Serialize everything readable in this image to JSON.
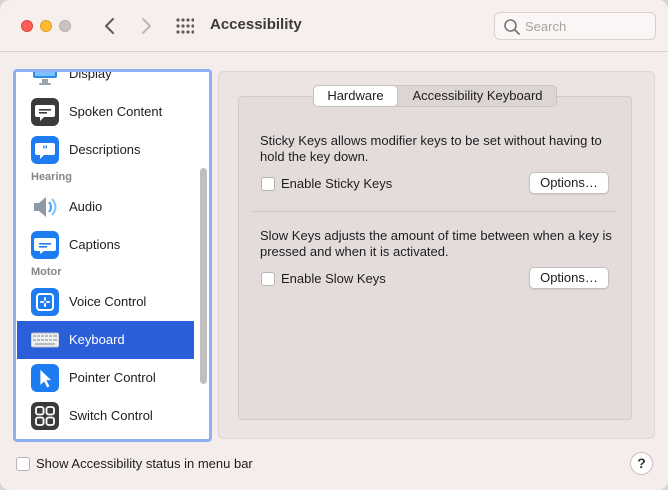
{
  "window": {
    "title": "Accessibility",
    "search_placeholder": "Search"
  },
  "sidebar": {
    "items": [
      {
        "label": "Display",
        "icon": "display-icon"
      },
      {
        "label": "Spoken Content",
        "icon": "spoken-content-icon"
      },
      {
        "label": "Descriptions",
        "icon": "descriptions-icon"
      },
      {
        "label": "Audio",
        "icon": "speaker-icon"
      },
      {
        "label": "Captions",
        "icon": "captions-icon"
      },
      {
        "label": "Voice Control",
        "icon": "voice-control-icon"
      },
      {
        "label": "Keyboard",
        "icon": "keyboard-icon",
        "selected": true
      },
      {
        "label": "Pointer Control",
        "icon": "pointer-icon"
      },
      {
        "label": "Switch Control",
        "icon": "switch-control-icon"
      }
    ],
    "sections": [
      "Hearing",
      "Motor"
    ],
    "selected_color": "#2b5fd9"
  },
  "tabs": [
    "Hardware",
    "Accessibility Keyboard"
  ],
  "sticky_keys": {
    "description": "Sticky Keys allows modifier keys to be set without having to hold the key down.",
    "checkbox_label": "Enable Sticky Keys",
    "options_label": "Options…"
  },
  "slow_keys": {
    "description": "Slow Keys adjusts the amount of time between when a key is pressed and when it is activated.",
    "checkbox_label": "Enable Slow Keys",
    "options_label": "Options…"
  },
  "footer": {
    "status_checkbox_label": "Show Accessibility status in menu bar",
    "help_label": "?"
  }
}
